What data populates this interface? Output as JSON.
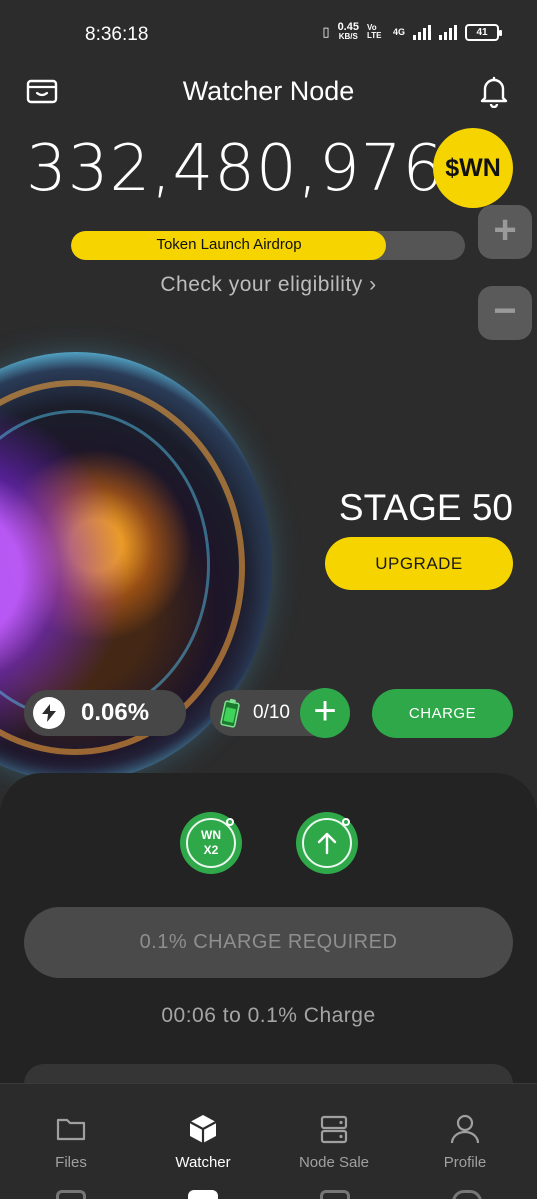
{
  "status_bar": {
    "time": "8:36:18",
    "speed_value": "0.45",
    "speed_unit": "KB/S",
    "volte": "Vo LTE",
    "network": "4G",
    "battery": "41"
  },
  "header": {
    "title": "Watcher Node",
    "wallet_icon": "wallet-icon",
    "bell_icon": "bell-icon"
  },
  "balance": {
    "amount": "332,480,976",
    "token": "$WN"
  },
  "zoom": {
    "in_label": "+",
    "out_label": "−"
  },
  "airdrop": {
    "label": "Token Launch Airdrop",
    "progress": 0.8,
    "eligibility_link": "Check your eligibility ›"
  },
  "node": {
    "stage": "STAGE 50",
    "upgrade_label": "UPGRADE",
    "boost_value": "0.06%",
    "battery_count": "0/10",
    "add_battery_label": "+",
    "charge_label": "CHARGE"
  },
  "sheet": {
    "multiplier_line1": "WN",
    "multiplier_line2": "X2",
    "charge_required": "0.1% CHARGE REQUIRED",
    "timer": "00:06 to 0.1% Charge"
  },
  "nav": {
    "items": [
      {
        "label": "Files",
        "icon": "folder-icon"
      },
      {
        "label": "Watcher",
        "icon": "cube-icon"
      },
      {
        "label": "Node Sale",
        "icon": "server-icon"
      },
      {
        "label": "Profile",
        "icon": "user-icon"
      }
    ],
    "active": "Watcher"
  },
  "colors": {
    "accent_yellow": "#f5d400",
    "accent_green": "#2fa84a",
    "background": "#2c2c2c"
  }
}
